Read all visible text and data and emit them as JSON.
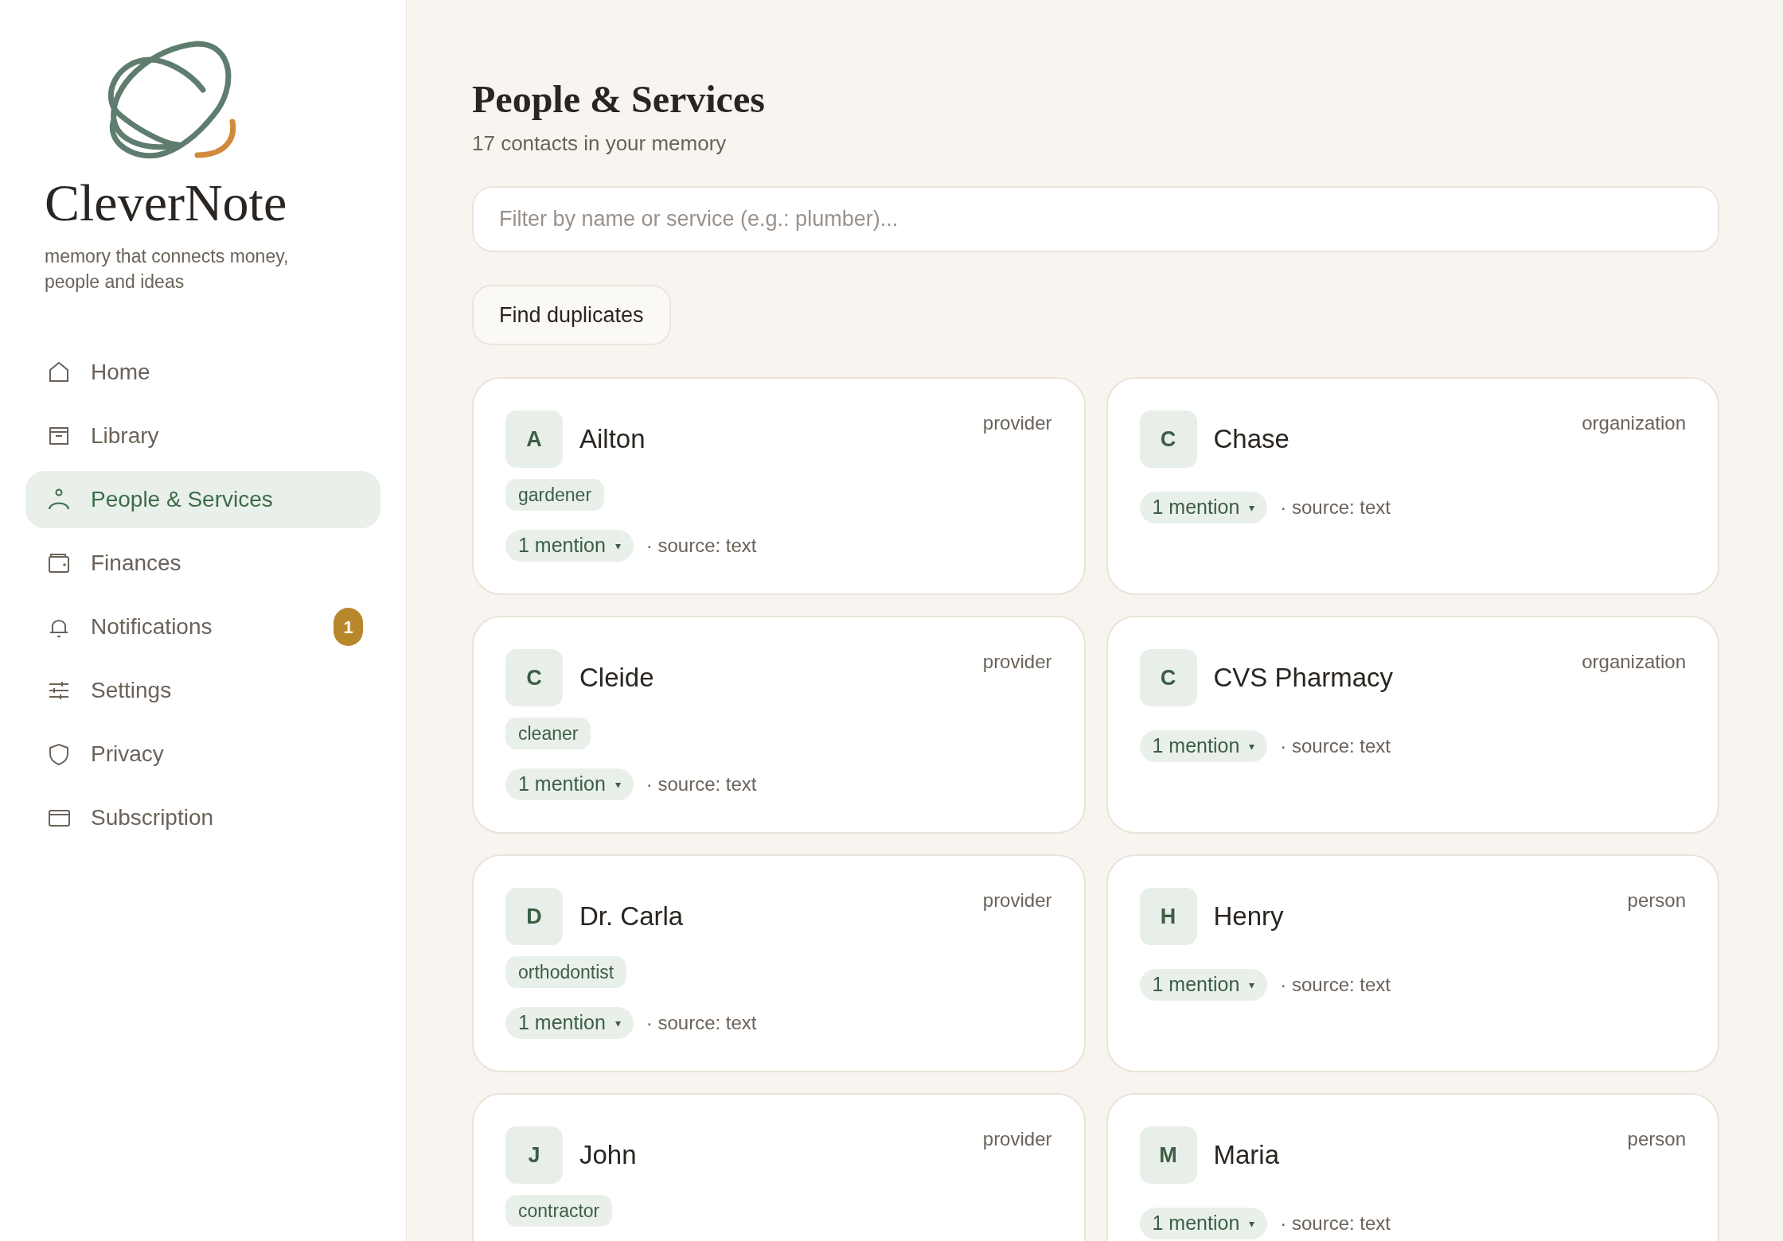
{
  "brand": {
    "name": "CleverNote",
    "tagline": "memory that connects money, people and ideas"
  },
  "nav": [
    {
      "label": "Home",
      "kind": "home",
      "selected": false
    },
    {
      "label": "Library",
      "kind": "library",
      "selected": false
    },
    {
      "label": "People & Services",
      "kind": "people",
      "selected": true
    },
    {
      "label": "Finances",
      "kind": "finances",
      "selected": false
    },
    {
      "label": "Notifications",
      "kind": "notifications",
      "selected": false,
      "badge": "1"
    },
    {
      "label": "Settings",
      "kind": "settings",
      "selected": false
    },
    {
      "label": "Privacy",
      "kind": "privacy",
      "selected": false
    },
    {
      "label": "Subscription",
      "kind": "subscription",
      "selected": false
    }
  ],
  "header": {
    "title": "People & Services",
    "subtitle": "17 contacts in your memory"
  },
  "search": {
    "placeholder": "Filter by name or service (e.g.: plumber)..."
  },
  "find_duplicates_button": "Find duplicates",
  "contacts": [
    {
      "initial": "A",
      "name": "Ailton",
      "type": "provider",
      "tags": [
        "gardener"
      ],
      "mentions": "1 mention",
      "caret": "▾",
      "source": "· source: text"
    },
    {
      "initial": "C",
      "name": "Chase",
      "type": "organization",
      "mentions": "1 mention",
      "caret": "▾",
      "source": "· source: text"
    },
    {
      "initial": "C",
      "name": "Cleide",
      "type": "provider",
      "tags": [
        "cleaner"
      ],
      "mentions": "1 mention",
      "caret": "▾",
      "source": "· source: text"
    },
    {
      "initial": "C",
      "name": "CVS Pharmacy",
      "type": "organization",
      "mentions": "1 mention",
      "caret": "▾",
      "source": "· source: text"
    },
    {
      "initial": "D",
      "name": "Dr. Carla",
      "type": "provider",
      "tags": [
        "orthodontist"
      ],
      "mentions": "1 mention",
      "caret": "▾",
      "source": "· source: text"
    },
    {
      "initial": "H",
      "name": "Henry",
      "type": "person",
      "mentions": "1 mention",
      "caret": "▾",
      "source": "· source: text"
    },
    {
      "initial": "J",
      "name": "John",
      "type": "provider",
      "tags": [
        "contractor"
      ]
    },
    {
      "initial": "M",
      "name": "Maria",
      "type": "person",
      "mentions": "1 mention",
      "caret": "▾",
      "source": "· source: text"
    }
  ]
}
